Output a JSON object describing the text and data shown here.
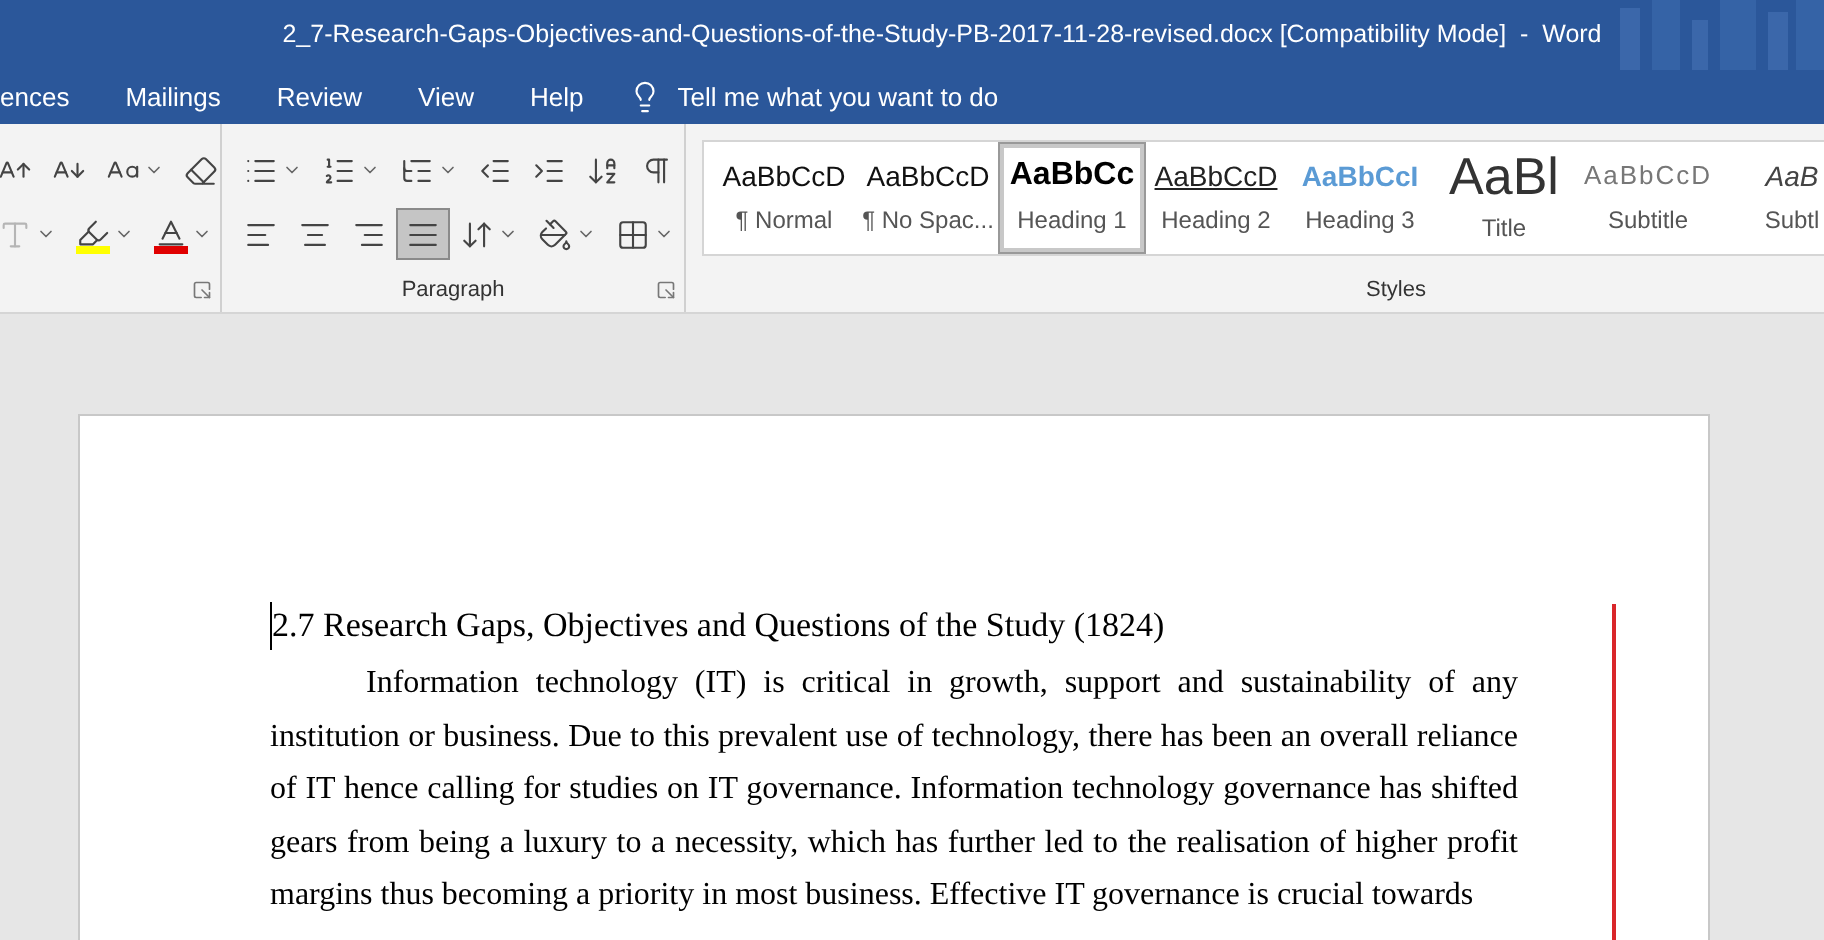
{
  "window": {
    "title": "2_7-Research-Gaps-Objectives-and-Questions-of-the-Study-PB-2017-11-28-revised.docx [Compatibility Mode]  -  Word"
  },
  "tabs": [
    {
      "label": "ences",
      "selected": false
    },
    {
      "label": "Mailings",
      "selected": false
    },
    {
      "label": "Review",
      "selected": false
    },
    {
      "label": "View",
      "selected": false
    },
    {
      "label": "Help",
      "selected": false
    }
  ],
  "tell_me": {
    "placeholder": "Tell me what you want to do"
  },
  "font_group": {
    "tools": [
      {
        "kind": "grow",
        "disabled": false
      },
      {
        "kind": "shrink",
        "disabled": false
      },
      {
        "kind": "case",
        "disabled": false
      },
      {
        "kind": "clear",
        "disabled": false
      },
      {
        "kind": "effects",
        "disabled": true
      },
      {
        "kind": "highlight",
        "disabled": false,
        "color": "#ffff00"
      },
      {
        "kind": "fontcolor",
        "disabled": false,
        "color": "#e00000"
      }
    ]
  },
  "paragraph_group": {
    "label": "Paragraph",
    "tools": [
      {
        "kind": "bullets",
        "selected": false
      },
      {
        "kind": "numbering",
        "selected": false
      },
      {
        "kind": "multilevel",
        "selected": false
      },
      {
        "kind": "outdent",
        "selected": false
      },
      {
        "kind": "indent",
        "selected": false
      },
      {
        "kind": "sort",
        "selected": false
      },
      {
        "kind": "marks",
        "selected": false
      },
      {
        "kind": "left",
        "selected": false
      },
      {
        "kind": "center",
        "selected": false
      },
      {
        "kind": "right",
        "selected": false
      },
      {
        "kind": "justify",
        "selected": true
      },
      {
        "kind": "spacing",
        "selected": false
      },
      {
        "kind": "shading",
        "selected": false
      },
      {
        "kind": "borders",
        "selected": false
      }
    ]
  },
  "styles_group": {
    "label": "Styles",
    "items": [
      {
        "kind": "normal",
        "preview": "AaBbCcD",
        "label": "¶ Normal",
        "selected": false
      },
      {
        "kind": "nospacing",
        "preview": "AaBbCcD",
        "label": "¶ No Spac...",
        "selected": false
      },
      {
        "kind": "heading1",
        "preview": "AaBbCc",
        "label": "Heading 1",
        "selected": true
      },
      {
        "kind": "heading2",
        "preview": "AaBbCcD",
        "label": "Heading 2",
        "selected": false
      },
      {
        "kind": "heading3",
        "preview": "AaBbCcI",
        "label": "Heading 3",
        "selected": false
      },
      {
        "kind": "title",
        "preview": "AaBl",
        "label": "Title",
        "selected": false
      },
      {
        "kind": "subtitle",
        "preview": "AaBbCcD",
        "label": "Subtitle",
        "selected": false
      },
      {
        "kind": "subtle",
        "preview": "AaB",
        "label": "Subtl",
        "selected": false
      }
    ]
  },
  "document": {
    "heading": "2.7 Research Gaps, Objectives and Questions of the Study (1824)",
    "paragraph": "Information technology (IT) is critical in growth, support and sustainability of any institution or business. Due to this prevalent use of technology, there has been an overall reliance of IT hence calling for studies on IT governance. Information technology governance has shifted gears from being a luxury to a necessity, which has further led to the realisation of higher profit margins thus becoming a priority in most business. Effective IT governance is crucial towards",
    "revision_bar": true
  }
}
